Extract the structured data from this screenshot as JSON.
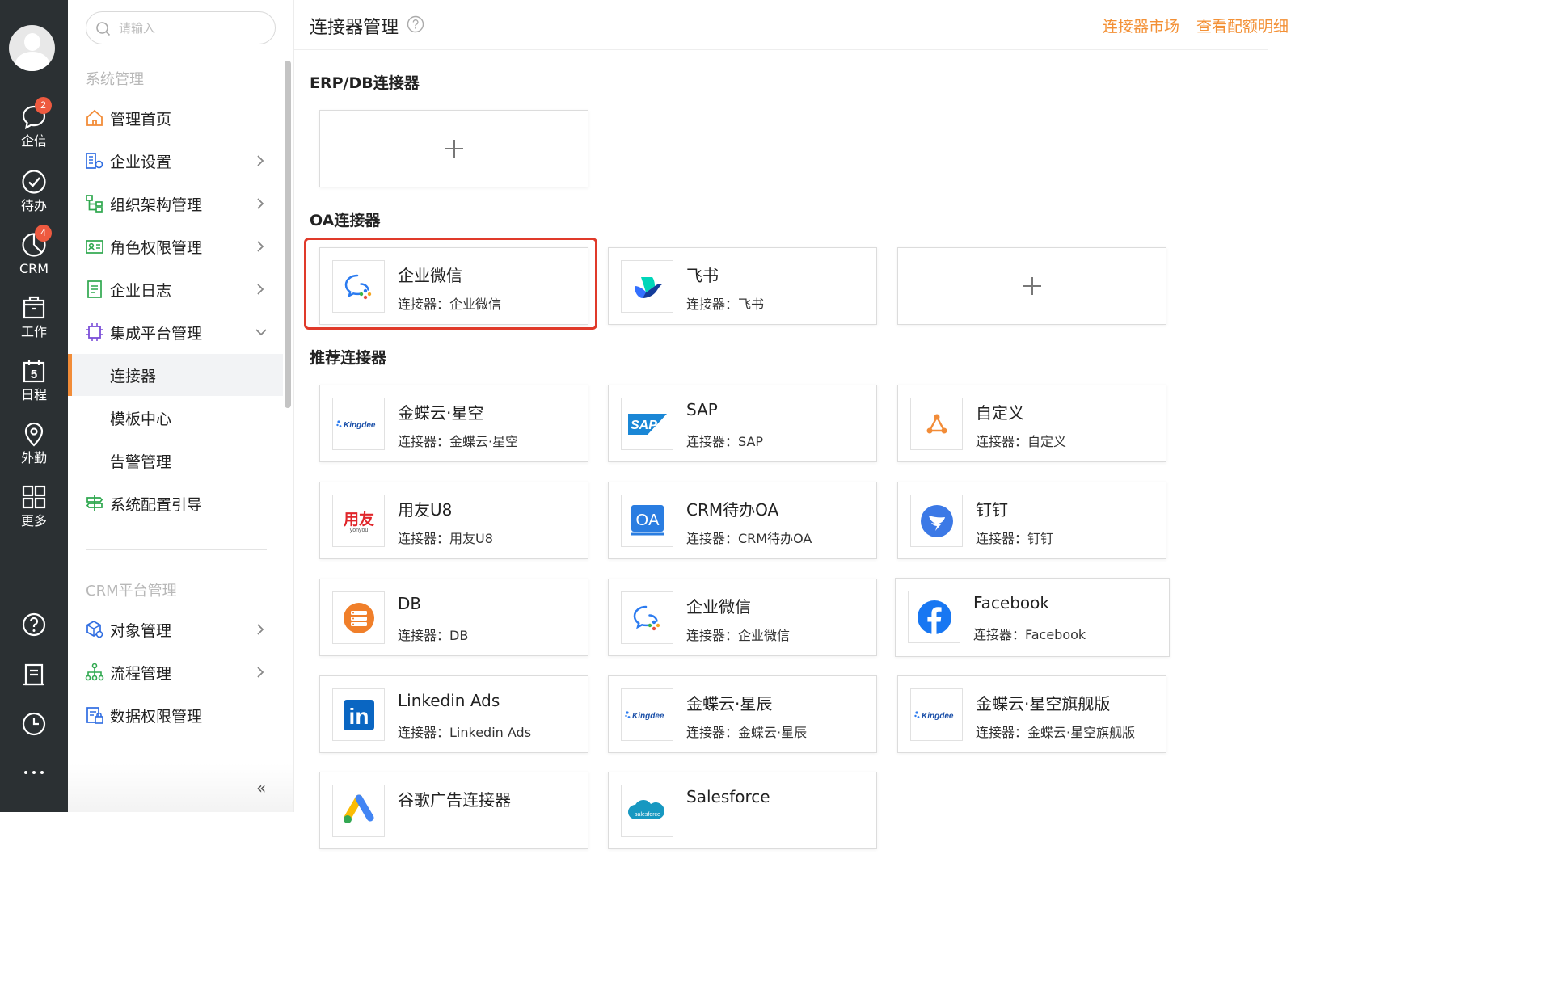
{
  "rail": {
    "items": [
      {
        "label": "企信",
        "badge": "2",
        "icon": "chat-bubble-icon"
      },
      {
        "label": "待办",
        "badge": "",
        "icon": "check-circle-icon"
      },
      {
        "label": "CRM",
        "badge": "4",
        "icon": "pie-chart-icon"
      },
      {
        "label": "工作",
        "badge": "",
        "icon": "briefcase-icon"
      },
      {
        "label": "日程",
        "badge": "",
        "icon": "calendar-icon",
        "calendar_day": "5"
      },
      {
        "label": "外勤",
        "badge": "",
        "icon": "location-pin-icon"
      },
      {
        "label": "更多",
        "badge": "",
        "icon": "grid-icon"
      }
    ],
    "tools": [
      "help-icon",
      "document-icon",
      "clock-icon",
      "more-dots-icon"
    ]
  },
  "nav": {
    "search_placeholder": "请输入",
    "group_system": "系统管理",
    "group_crm": "CRM平台管理",
    "items": [
      {
        "label": "管理首页"
      },
      {
        "label": "企业设置"
      },
      {
        "label": "组织架构管理"
      },
      {
        "label": "角色权限管理"
      },
      {
        "label": "企业日志"
      },
      {
        "label": "集成平台管理"
      },
      {
        "label": "连接器"
      },
      {
        "label": "模板中心"
      },
      {
        "label": "告警管理"
      },
      {
        "label": "系统配置引导"
      },
      {
        "label": "对象管理"
      },
      {
        "label": "流程管理"
      },
      {
        "label": "数据权限管理"
      }
    ],
    "collapse": "«"
  },
  "header": {
    "title": "连接器管理",
    "link_market": "连接器市场",
    "link_quota": "查看配额明细"
  },
  "sections": {
    "erp": "ERP/DB连接器",
    "oa": "OA连接器",
    "recommended": "推荐连接器"
  },
  "oa_cards": [
    {
      "name": "企业微信",
      "sub": "连接器：企业微信"
    },
    {
      "name": "飞书",
      "sub": "连接器：飞书"
    }
  ],
  "rec_cards": [
    {
      "name": "金蝶云·星空",
      "sub": "连接器：金蝶云·星空",
      "logo_text": "Kingdee"
    },
    {
      "name": "SAP",
      "sub": "连接器：SAP",
      "logo_text": "SAP"
    },
    {
      "name": "自定义",
      "sub": "连接器：自定义"
    },
    {
      "name": "用友U8",
      "sub": "连接器：用友U8",
      "logo_text": "用友",
      "logo_sub": "yonyou"
    },
    {
      "name": "CRM待办OA",
      "sub": "连接器：CRM待办OA",
      "logo_text": "OA"
    },
    {
      "name": "钉钉",
      "sub": "连接器：钉钉"
    },
    {
      "name": "DB",
      "sub": "连接器：DB"
    },
    {
      "name": "企业微信",
      "sub": "连接器：企业微信"
    },
    {
      "name": "Facebook",
      "sub": "连接器：Facebook"
    },
    {
      "name": "Linkedin Ads",
      "sub": "连接器：Linkedin Ads",
      "logo_text": "in"
    },
    {
      "name": "金蝶云·星辰",
      "sub": "连接器：金蝶云·星辰",
      "logo_text": "Kingdee"
    },
    {
      "name": "金蝶云·星空旗舰版",
      "sub": "连接器：金蝶云·星空旗舰版",
      "logo_text": "Kingdee"
    },
    {
      "name": "谷歌广告连接器",
      "sub": ""
    },
    {
      "name": "Salesforce",
      "sub": "",
      "logo_text": "salesforce"
    }
  ],
  "colors": {
    "accent": "#f39035",
    "rail_bg": "#2b3033",
    "highlight": "#e03a2a",
    "badge": "#ee5a40"
  }
}
